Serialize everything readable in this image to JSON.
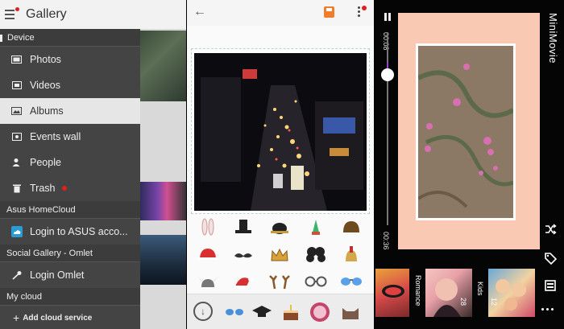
{
  "gallery": {
    "title": "Gallery",
    "sections": {
      "device": "Device",
      "homecloud": "Asus HomeCloud",
      "social": "Social Gallery - Omlet",
      "mycloud": "My cloud"
    },
    "items": [
      {
        "label": "Photos",
        "icon": "photos-icon"
      },
      {
        "label": "Videos",
        "icon": "videos-icon"
      },
      {
        "label": "Albums",
        "icon": "albums-icon",
        "selected": true
      },
      {
        "label": "Events wall",
        "icon": "events-icon"
      },
      {
        "label": "People",
        "icon": "people-icon"
      },
      {
        "label": "Trash",
        "icon": "trash-icon",
        "badge": true
      }
    ],
    "homecloud_login": "Login to ASUS acco...",
    "omlet_login": "Login Omlet",
    "add_cloud": "Add cloud service"
  },
  "editor": {
    "back_icon": "back-arrow-icon",
    "save_icon": "save-icon",
    "more_icon": "more-vert-icon"
  },
  "minimovie": {
    "title": "MiniMovie",
    "time_start": "00:08",
    "time_end": "00:36",
    "progress": 0.22,
    "themes": [
      {
        "label": "",
        "count": ""
      },
      {
        "label": "Romance",
        "count": "28"
      },
      {
        "label": "Kids",
        "count": "12"
      }
    ]
  },
  "colors": {
    "accent_orange": "#f07d2a",
    "slider_purple": "#a23bdc",
    "peach": "#f9c9b4",
    "badge_red": "#e02020"
  }
}
